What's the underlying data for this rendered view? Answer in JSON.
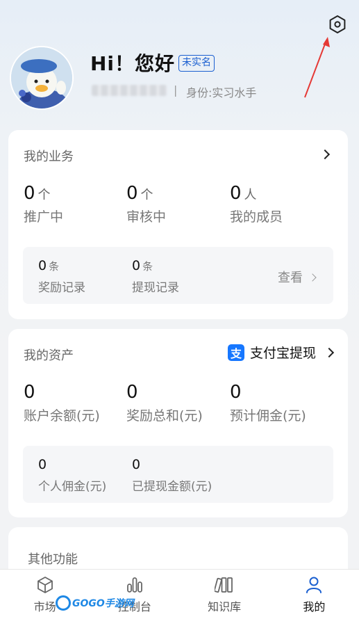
{
  "header": {
    "greeting": "Hi！您好",
    "verify_badge": "未实名",
    "separator": "|",
    "role": "身份:实习水手"
  },
  "business": {
    "title": "我的业务",
    "stats": [
      {
        "value": "0",
        "unit": "个",
        "label": "推广中"
      },
      {
        "value": "0",
        "unit": "个",
        "label": "审核中"
      },
      {
        "value": "0",
        "unit": "人",
        "label": "我的成员"
      }
    ],
    "records": [
      {
        "value": "0",
        "unit": "条",
        "label": "奖励记录"
      },
      {
        "value": "0",
        "unit": "条",
        "label": "提现记录"
      }
    ],
    "view_label": "查看"
  },
  "assets": {
    "title": "我的资产",
    "alipay_label": "支付宝提现",
    "alipay_icon_glyph": "支",
    "stats": [
      {
        "value": "0",
        "label": "账户余额(元)"
      },
      {
        "value": "0",
        "label": "奖励总和(元)"
      },
      {
        "value": "0",
        "label": "预计佣金(元)"
      }
    ],
    "sub": [
      {
        "value": "0",
        "label": "个人佣金(元)"
      },
      {
        "value": "0",
        "label": "已提现金额(元)"
      }
    ]
  },
  "other": {
    "title": "其他功能"
  },
  "tabbar": {
    "tabs": [
      {
        "label": "市场",
        "icon": "cube-icon"
      },
      {
        "label": "控制台",
        "icon": "bar-chart-icon"
      },
      {
        "label": "知识库",
        "icon": "books-icon"
      },
      {
        "label": "我的",
        "icon": "user-icon"
      }
    ],
    "active_index": 3
  },
  "watermark": {
    "text": "GOGO手游网"
  },
  "colors": {
    "accent": "#1a5fd0",
    "alipay": "#1677ff",
    "annotation": "#e53935"
  }
}
